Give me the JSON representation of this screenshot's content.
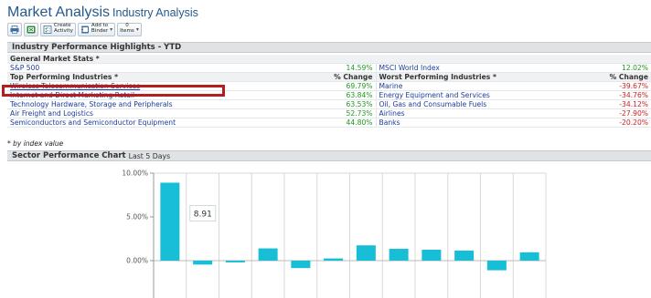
{
  "page": {
    "title": "Market Analysis",
    "subtitle": "Industry Analysis"
  },
  "toolbar": {
    "print_icon": "print-icon",
    "export_icon": "export-icon",
    "create_activity_label_1": "Create",
    "create_activity_label_2": "Activity",
    "add_to_binder_label_1": "Add to",
    "add_to_binder_label_2": "Binder",
    "items_count": "0",
    "items_label": "Items"
  },
  "highlights": {
    "title": "Industry Performance Highlights - YTD",
    "general_header": "General Market Stats *",
    "sp500": {
      "name": "S&P 500",
      "value": "14.59%"
    },
    "msci": {
      "name": "MSCI World Index",
      "value": "12.02%"
    },
    "top_header": "Top Performing Industries *",
    "worst_header": "Worst Performing Industries *",
    "change_header": "% Change",
    "top": [
      {
        "name": "Wireless Telecommunication Services",
        "value": "69.79%"
      },
      {
        "name": "Internet and Direct Marketing Retail",
        "value": "63.84%"
      },
      {
        "name": "Technology Hardware, Storage and Peripherals",
        "value": "63.53%"
      },
      {
        "name": "Air Freight and Logistics",
        "value": "52.73%"
      },
      {
        "name": "Semiconductors and Semiconductor Equipment",
        "value": "44.80%"
      }
    ],
    "worst": [
      {
        "name": "Marine",
        "value": "-39.67%"
      },
      {
        "name": "Energy Equipment and Services",
        "value": "-34.76%"
      },
      {
        "name": "Oil, Gas and Consumable Fuels",
        "value": "-34.12%"
      },
      {
        "name": "Airlines",
        "value": "-27.90%"
      },
      {
        "name": "Banks",
        "value": "-20.20%"
      }
    ],
    "footnote": "* by index value"
  },
  "sector_chart": {
    "title": "Sector Performance Chart",
    "period": "Last 5 Days"
  },
  "colors": {
    "bar": "#17bed6",
    "positive": "#1f9a1f",
    "negative": "#d02020",
    "link": "#1a3c9c",
    "title": "#245a8c",
    "highlight_box": "#b51e1e"
  },
  "chart_data": {
    "type": "bar",
    "values": [
      8.91,
      -0.45,
      -0.2,
      1.4,
      -0.85,
      0.25,
      1.75,
      1.35,
      1.25,
      1.15,
      -1.1,
      0.95
    ],
    "yticks": [
      "10.00%",
      "5.00%",
      "0.00%"
    ],
    "ylim": [
      -4,
      10
    ],
    "tooltip": "8.91",
    "grid": true
  }
}
